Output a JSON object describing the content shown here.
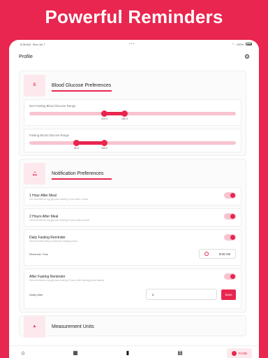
{
  "hero": {
    "title": "Powerful Reminders"
  },
  "status_bar": {
    "time": "8:38 AM",
    "date": "Mon Jul 7",
    "center": "•••",
    "battery": "100%"
  },
  "app_bar": {
    "title": "Profile"
  },
  "blood_glucose": {
    "avatar_letter": "B",
    "title": "Blood Glucose Preferences",
    "non_fasting": {
      "label": "Non-Fasting Blood Glucose Range",
      "low": "120.0",
      "high": "150.0",
      "low_fraction": 0.363,
      "high_fraction": 0.461
    },
    "fasting": {
      "label": "Fasting Blood Glucose Range",
      "low": "80.0",
      "high": "100.0",
      "low_fraction": 0.228,
      "high_fraction": 0.363
    }
  },
  "notifications": {
    "title": "Notification Preferences",
    "items": [
      {
        "title": "1 Hour After Meal",
        "subtitle": "Get reminded to log glucose reading 1 hour after a meal",
        "enabled": true
      },
      {
        "title": "2 Hours After Meal",
        "subtitle": "Get reminded to log glucose reading 2 hours after a meal",
        "enabled": true
      },
      {
        "title": "Daily Fasting Reminder",
        "subtitle": "Get reminded daily to start your fasting period",
        "enabled": true,
        "sub_label": "Reminder Time",
        "sub_value": "8:00 AM"
      },
      {
        "title": "After Fasting Reminder",
        "subtitle": "Get reminded to log glucose reading 2 hours after fasting period started",
        "enabled": true,
        "sub_label": "Notify After",
        "sub_value": "2",
        "button": "Save"
      }
    ]
  },
  "measurement": {
    "title": "Measurement Units"
  },
  "bottom_nav": {
    "active_label": "Profile"
  },
  "colors": {
    "accent": "#e8264f",
    "accent_light": "#fde9ed"
  }
}
